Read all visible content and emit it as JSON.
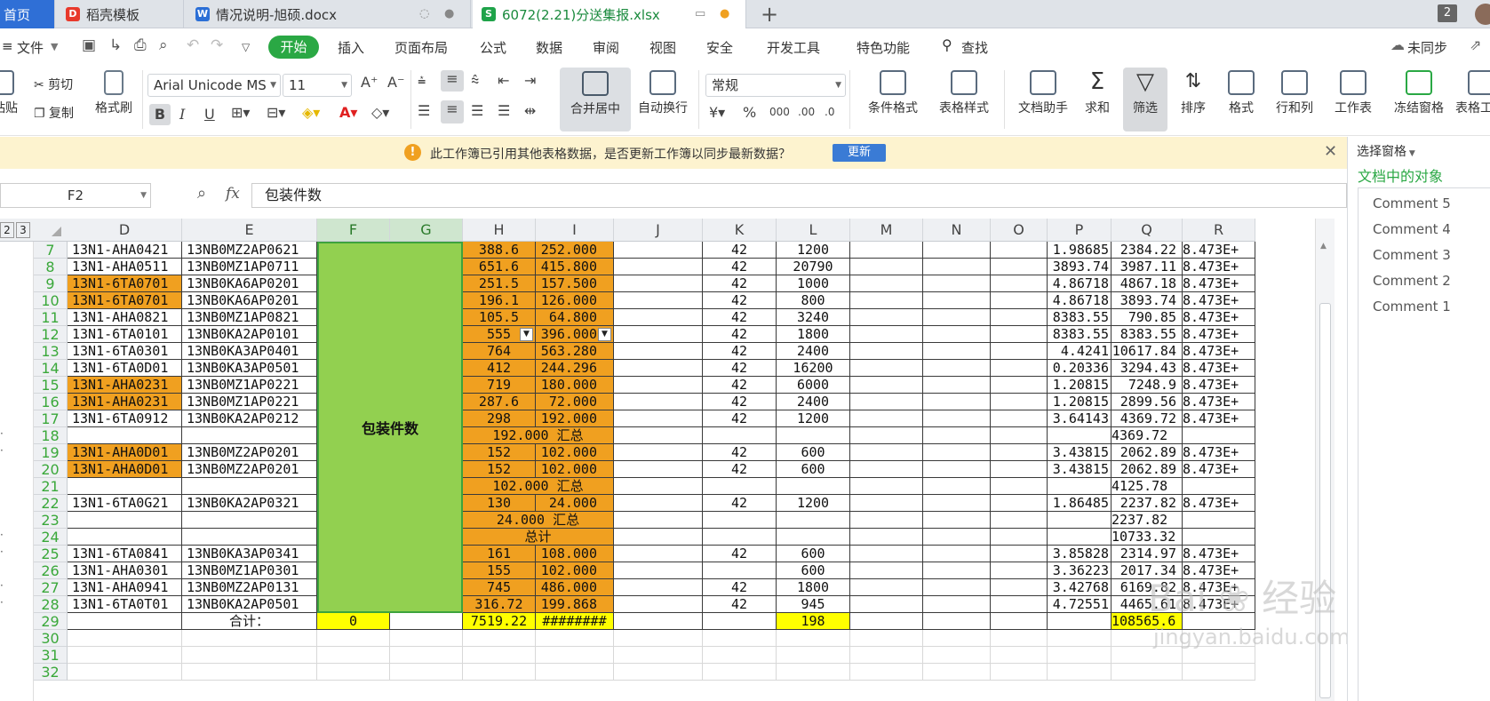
{
  "tabs": [
    {
      "label": "首页",
      "active": true
    },
    {
      "label": "稻壳模板"
    },
    {
      "label": "情况说明-旭硕.docx"
    },
    {
      "label": "6072(2.21)分送集报.xlsx"
    }
  ],
  "window_count": "2",
  "menu": {
    "file": "文件",
    "start": "开始",
    "insert": "插入",
    "layout": "页面布局",
    "formula": "公式",
    "data": "数据",
    "review": "审阅",
    "view": "视图",
    "security": "安全",
    "dev": "开发工具",
    "special": "特色功能",
    "search": "查找",
    "sync": "未同步"
  },
  "ribbon": {
    "paste": "粘贴",
    "cut": "剪切",
    "copy": "复制",
    "format_painter": "格式刷",
    "font_name": "Arial Unicode MS",
    "font_size": "11",
    "bold": "B",
    "italic": "I",
    "underline": "U",
    "merge": "合并居中",
    "wrap": "自动换行",
    "number_format": "常规",
    "cond_format": "条件格式",
    "table_style": "表格样式",
    "doc_helper": "文档助手",
    "sum": "求和",
    "filter": "筛选",
    "sort": "排序",
    "format": "格式",
    "row_col": "行和列",
    "worksheet": "工作表",
    "freeze": "冻结窗格",
    "table_tools": "表格工"
  },
  "notification": {
    "text": "此工作簿已引用其他表格数据，是否更新工作簿以同步最新数据？",
    "button": "更新"
  },
  "formula_bar": {
    "name_box": "F2",
    "fx": "fx",
    "content": "包装件数"
  },
  "outline_levels": [
    "2",
    "3"
  ],
  "columns": [
    "D",
    "E",
    "F",
    "G",
    "H",
    "I",
    "J",
    "K",
    "L",
    "M",
    "N",
    "O",
    "P",
    "Q",
    "R"
  ],
  "merged_label": "包装件数",
  "rows": [
    {
      "n": "7",
      "D": "13N1-AHA0421",
      "E": "13NB0MZ2AP0621",
      "H": "388.6",
      "I": "252.000",
      "K": "42",
      "L": "1200",
      "P": "1.98685",
      "Q": "2384.22",
      "R": "8.473E+"
    },
    {
      "n": "8",
      "D": "13N1-AHA0511",
      "E": "13NB0MZ1AP0711",
      "H": "651.6",
      "I": "415.800",
      "K": "42",
      "L": "20790",
      "P": "3893.74",
      "Q": "3987.11",
      "R": "8.473E+"
    },
    {
      "n": "9",
      "D": "13N1-6TA0701",
      "E": "13NB0KA6AP0201",
      "H": "251.5",
      "I": "157.500",
      "K": "42",
      "L": "1000",
      "P": "4.86718",
      "Q": "4867.18",
      "R": "8.473E+",
      "Dfill": true
    },
    {
      "n": "10",
      "D": "13N1-6TA0701",
      "E": "13NB0KA6AP0201",
      "H": "196.1",
      "I": "126.000",
      "K": "42",
      "L": "800",
      "P": "4.86718",
      "Q": "3893.74",
      "R": "8.473E+",
      "Dfill": true
    },
    {
      "n": "11",
      "D": "13N1-AHA0821",
      "E": "13NB0MZ1AP0821",
      "H": "105.5",
      "I": "64.800",
      "K": "42",
      "L": "3240",
      "P": "8383.55",
      "Q": "790.85",
      "R": "8.473E+"
    },
    {
      "n": "12",
      "D": "13N1-6TA0101",
      "E": "13NB0KA2AP0101",
      "H": "555",
      "I": "396.000",
      "K": "42",
      "L": "1800",
      "P": "8383.55",
      "Q": "8383.55",
      "R": "8.473E+",
      "dd": true
    },
    {
      "n": "13",
      "D": "13N1-6TA0301",
      "E": "13NB0KA3AP0401",
      "H": "764",
      "I": "563.280",
      "K": "42",
      "L": "2400",
      "P": "4.4241",
      "Q": "10617.84",
      "R": "8.473E+"
    },
    {
      "n": "14",
      "D": "13N1-6TA0D01",
      "E": "13NB0KA3AP0501",
      "H": "412",
      "I": "244.296",
      "K": "42",
      "L": "16200",
      "P": "0.20336",
      "Q": "3294.43",
      "R": "8.473E+"
    },
    {
      "n": "15",
      "D": "13N1-AHA0231",
      "E": "13NB0MZ1AP0221",
      "H": "719",
      "I": "180.000",
      "K": "42",
      "L": "6000",
      "P": "1.20815",
      "Q": "7248.9",
      "R": "8.473E+",
      "Dfill": true
    },
    {
      "n": "16",
      "D": "13N1-AHA0231",
      "E": "13NB0MZ1AP0221",
      "H": "287.6",
      "I": "72.000",
      "K": "42",
      "L": "2400",
      "P": "1.20815",
      "Q": "2899.56",
      "R": "8.473E+",
      "Dfill": true
    },
    {
      "n": "17",
      "D": "13N1-6TA0912",
      "E": "13NB0KA2AP0212",
      "H": "298",
      "I": "192.000",
      "K": "42",
      "L": "1200",
      "P": "3.64143",
      "Q": "4369.72",
      "R": "8.473E+"
    },
    {
      "n": "18",
      "summary": "192.000  汇总",
      "Q": "4369.72"
    },
    {
      "n": "19",
      "D": "13N1-AHA0D01",
      "E": "13NB0MZ2AP0201",
      "H": "152",
      "I": "102.000",
      "K": "42",
      "L": "600",
      "P": "3.43815",
      "Q": "2062.89",
      "R": "8.473E+",
      "Dfill": true
    },
    {
      "n": "20",
      "D": "13N1-AHA0D01",
      "E": "13NB0MZ2AP0201",
      "H": "152",
      "I": "102.000",
      "K": "42",
      "L": "600",
      "P": "3.43815",
      "Q": "2062.89",
      "R": "8.473E+",
      "Dfill": true
    },
    {
      "n": "21",
      "summary": "102.000  汇总",
      "Q": "4125.78"
    },
    {
      "n": "22",
      "D": "13N1-6TA0G21",
      "E": "13NB0KA2AP0321",
      "H": "130",
      "I": "24.000",
      "K": "42",
      "L": "1200",
      "P": "1.86485",
      "Q": "2237.82",
      "R": "8.473E+"
    },
    {
      "n": "23",
      "summary": "24.000  汇总",
      "Q": "2237.82"
    },
    {
      "n": "24",
      "summary": "总计",
      "Q": "10733.32"
    },
    {
      "n": "25",
      "D": "13N1-6TA0841",
      "E": "13NB0KA3AP0341",
      "H": "161",
      "I": "108.000",
      "K": "42",
      "L": "600",
      "P": "3.85828",
      "Q": "2314.97",
      "R": "8.473E+"
    },
    {
      "n": "26",
      "D": "13N1-AHA0301",
      "E": "13NB0MZ1AP0301",
      "H": "155",
      "I": "102.000",
      "K": "",
      "L": "600",
      "P": "3.36223",
      "Q": "2017.34",
      "R": "8.473E+"
    },
    {
      "n": "27",
      "D": "13N1-AHA0941",
      "E": "13NB0MZ2AP0131",
      "H": "745",
      "I": "486.000",
      "K": "42",
      "L": "1800",
      "P": "3.42768",
      "Q": "6169.82",
      "R": "8.473E+"
    },
    {
      "n": "28",
      "D": "13N1-6TA0T01",
      "E": "13NB0KA2AP0501",
      "H": "316.72",
      "I": "199.868",
      "K": "42",
      "L": "945",
      "P": "4.72551",
      "Q": "4465.61",
      "R": "8.473E+"
    },
    {
      "n": "29",
      "total": true,
      "E": "合计：",
      "F": "0",
      "H": "7519.22",
      "I": "########",
      "L": "198",
      "Q": "108565.6"
    },
    {
      "n": "30",
      "empty": true
    },
    {
      "n": "31",
      "empty": true
    },
    {
      "n": "32",
      "empty": true
    }
  ],
  "pane": {
    "title": "选择窗格",
    "section": "文档中的对象",
    "items": [
      "Comment 5",
      "Comment 4",
      "Comment 3",
      "Comment 2",
      "Comment 1"
    ]
  },
  "watermark": "jingyan.baidu.com",
  "colors": {
    "orange": "#f0a020",
    "green": "#92d050",
    "yellow": "#ffff00",
    "accent": "#2aa844"
  }
}
